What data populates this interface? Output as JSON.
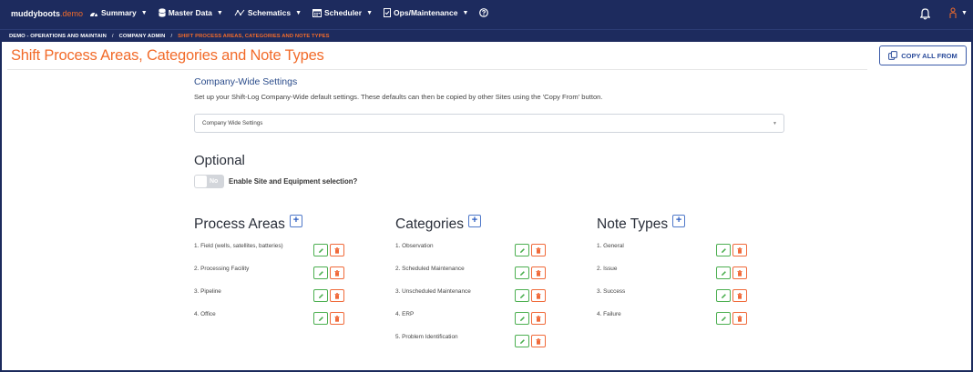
{
  "brand": {
    "name": "muddyboots",
    "suffix": ".demo"
  },
  "nav": {
    "summary": "Summary",
    "master_data": "Master Data",
    "schematics": "Schematics",
    "scheduler": "Scheduler",
    "ops": "Ops/Maintenance"
  },
  "breadcrumb": {
    "level1": "DEMO - OPERATIONS AND MAINTAIN",
    "level2": "COMPANY ADMIN",
    "level3": "SHIFT PROCESS AREAS, CATEGORIES AND NOTE TYPES"
  },
  "page": {
    "title": "Shift Process Areas, Categories and Note Types",
    "copy_button": "COPY ALL FROM"
  },
  "settings": {
    "heading": "Company-Wide Settings",
    "description": "Set up your Shift-Log Company-Wide default settings. These defaults can then be copied by other Sites using the 'Copy From' button.",
    "selected": "Company Wide Settings"
  },
  "optional": {
    "heading": "Optional",
    "toggle_value": "No",
    "toggle_label": "Enable Site and Equipment selection?"
  },
  "process_areas": {
    "heading": "Process Areas",
    "items": [
      "1. Field (wells, satellites, batteries)",
      "2. Processing Facility",
      "3. Pipeline",
      "4. Office"
    ]
  },
  "categories": {
    "heading": "Categories",
    "items": [
      "1. Observation",
      "2. Scheduled Maintenance",
      "3. Unscheduled Maintenance",
      "4. ERP",
      "5. Problem Identification"
    ]
  },
  "note_types": {
    "heading": "Note Types",
    "items": [
      "1. General",
      "2. Issue",
      "3. Success",
      "4. Failure"
    ]
  },
  "colors": {
    "navbar": "#1d2b5e",
    "accent_orange": "#f26b2a",
    "edit_green": "#4caf50",
    "delete_red": "#f06a3a",
    "link_blue": "#2b4c9b"
  }
}
